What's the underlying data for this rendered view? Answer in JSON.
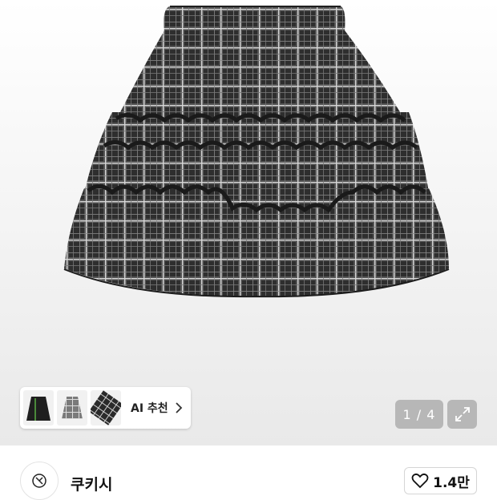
{
  "gallery": {
    "counter": "1 / 4",
    "image_subject": "plaid tiered ruffle skirt"
  },
  "ai_recommend": {
    "label": "AI 추천",
    "thumbnail_icons": [
      "black-plaid-skirt",
      "gray-plaid-skirt",
      "diagonal-plaid-skirt"
    ]
  },
  "seller": {
    "name": "쿠키시",
    "logo_icon": "brand-logo"
  },
  "like": {
    "count": "1.4만"
  },
  "colors": {
    "accent_text": "#111111",
    "counter_bg": "#8c8c8c"
  }
}
